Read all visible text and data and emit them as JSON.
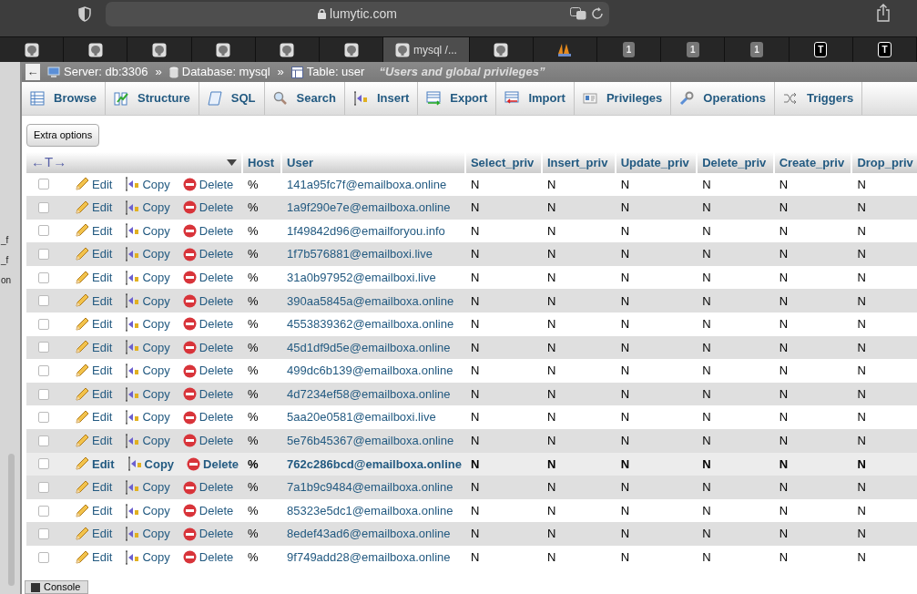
{
  "browser": {
    "address": "lumytic.com"
  },
  "browser_tabs": [
    {
      "kind": "pma",
      "selected": false
    },
    {
      "kind": "pma",
      "selected": false
    },
    {
      "kind": "pma",
      "selected": false
    },
    {
      "kind": "pma",
      "selected": false
    },
    {
      "kind": "pma",
      "selected": false
    },
    {
      "kind": "pma",
      "selected": false
    },
    {
      "kind": "pma",
      "selected": true,
      "title": "mysql /..."
    },
    {
      "kind": "pma",
      "selected": false
    },
    {
      "kind": "logo",
      "selected": false
    },
    {
      "kind": "badge",
      "selected": false,
      "text": "1"
    },
    {
      "kind": "badge",
      "selected": false,
      "text": "1"
    },
    {
      "kind": "badge",
      "selected": false,
      "text": "1"
    },
    {
      "kind": "letter",
      "selected": false,
      "text": "T"
    },
    {
      "kind": "letter",
      "selected": false,
      "text": "T"
    }
  ],
  "sidebar": {
    "fragments": [
      "_f",
      "_f",
      "on"
    ]
  },
  "breadcrumb": {
    "back": "←",
    "server": "Server: db:3306",
    "sep1": "»",
    "database": "Database: mysql",
    "sep2": "»",
    "table": "Table: user",
    "comment": "“Users and global privileges”"
  },
  "tabs": [
    {
      "label": "Browse",
      "selected": false
    },
    {
      "label": "Structure",
      "selected": false
    },
    {
      "label": "SQL",
      "selected": false
    },
    {
      "label": "Search",
      "selected": false
    },
    {
      "label": "Insert",
      "selected": false
    },
    {
      "label": "Export",
      "selected": false
    },
    {
      "label": "Import",
      "selected": false
    },
    {
      "label": "Privileges",
      "selected": false
    },
    {
      "label": "Operations",
      "selected": false
    },
    {
      "label": "Triggers",
      "selected": false
    }
  ],
  "extra_options": "Extra options",
  "table": {
    "arrows": "←T→",
    "columns": [
      "Host",
      "User",
      "Select_priv",
      "Insert_priv",
      "Update_priv",
      "Delete_priv",
      "Create_priv",
      "Drop_priv"
    ],
    "rows": [
      {
        "checked": false,
        "highlighted": false,
        "actions": [
          "Edit",
          "Copy",
          "Delete"
        ],
        "cells": [
          "%",
          "141a95fc7f@emailboxa.online",
          "N",
          "N",
          "N",
          "N",
          "N",
          "N"
        ]
      },
      {
        "checked": false,
        "highlighted": false,
        "actions": [
          "Edit",
          "Copy",
          "Delete"
        ],
        "cells": [
          "%",
          "1a9f290e7e@emailboxa.online",
          "N",
          "N",
          "N",
          "N",
          "N",
          "N"
        ]
      },
      {
        "checked": false,
        "highlighted": false,
        "actions": [
          "Edit",
          "Copy",
          "Delete"
        ],
        "cells": [
          "%",
          "1f49842d96@emailforyou.info",
          "N",
          "N",
          "N",
          "N",
          "N",
          "N"
        ]
      },
      {
        "checked": false,
        "highlighted": false,
        "actions": [
          "Edit",
          "Copy",
          "Delete"
        ],
        "cells": [
          "%",
          "1f7b576881@emailboxi.live",
          "N",
          "N",
          "N",
          "N",
          "N",
          "N"
        ]
      },
      {
        "checked": false,
        "highlighted": false,
        "actions": [
          "Edit",
          "Copy",
          "Delete"
        ],
        "cells": [
          "%",
          "31a0b97952@emailboxi.live",
          "N",
          "N",
          "N",
          "N",
          "N",
          "N"
        ]
      },
      {
        "checked": false,
        "highlighted": false,
        "actions": [
          "Edit",
          "Copy",
          "Delete"
        ],
        "cells": [
          "%",
          "390aa5845a@emailboxa.online",
          "N",
          "N",
          "N",
          "N",
          "N",
          "N"
        ]
      },
      {
        "checked": false,
        "highlighted": false,
        "actions": [
          "Edit",
          "Copy",
          "Delete"
        ],
        "cells": [
          "%",
          "4553839362@emailboxa.online",
          "N",
          "N",
          "N",
          "N",
          "N",
          "N"
        ]
      },
      {
        "checked": false,
        "highlighted": false,
        "actions": [
          "Edit",
          "Copy",
          "Delete"
        ],
        "cells": [
          "%",
          "45d1df9d5e@emailboxa.online",
          "N",
          "N",
          "N",
          "N",
          "N",
          "N"
        ]
      },
      {
        "checked": false,
        "highlighted": false,
        "actions": [
          "Edit",
          "Copy",
          "Delete"
        ],
        "cells": [
          "%",
          "499dc6b139@emailboxa.online",
          "N",
          "N",
          "N",
          "N",
          "N",
          "N"
        ]
      },
      {
        "checked": false,
        "highlighted": false,
        "actions": [
          "Edit",
          "Copy",
          "Delete"
        ],
        "cells": [
          "%",
          "4d7234ef58@emailboxa.online",
          "N",
          "N",
          "N",
          "N",
          "N",
          "N"
        ]
      },
      {
        "checked": false,
        "highlighted": false,
        "actions": [
          "Edit",
          "Copy",
          "Delete"
        ],
        "cells": [
          "%",
          "5aa20e0581@emailboxi.live",
          "N",
          "N",
          "N",
          "N",
          "N",
          "N"
        ]
      },
      {
        "checked": false,
        "highlighted": false,
        "actions": [
          "Edit",
          "Copy",
          "Delete"
        ],
        "cells": [
          "%",
          "5e76b45367@emailboxa.online",
          "N",
          "N",
          "N",
          "N",
          "N",
          "N"
        ]
      },
      {
        "checked": false,
        "highlighted": true,
        "actions": [
          "Edit",
          "Copy",
          "Delete"
        ],
        "cells": [
          "%",
          "762c286bcd@emailboxa.online",
          "N",
          "N",
          "N",
          "N",
          "N",
          "N"
        ]
      },
      {
        "checked": false,
        "highlighted": false,
        "actions": [
          "Edit",
          "Copy",
          "Delete"
        ],
        "cells": [
          "%",
          "7a1b9c9484@emailboxa.online",
          "N",
          "N",
          "N",
          "N",
          "N",
          "N"
        ]
      },
      {
        "checked": false,
        "highlighted": false,
        "actions": [
          "Edit",
          "Copy",
          "Delete"
        ],
        "cells": [
          "%",
          "85323e5dc1@emailboxa.online",
          "N",
          "N",
          "N",
          "N",
          "N",
          "N"
        ]
      },
      {
        "checked": false,
        "highlighted": false,
        "actions": [
          "Edit",
          "Copy",
          "Delete"
        ],
        "cells": [
          "%",
          "8edef43ad6@emailboxa.online",
          "N",
          "N",
          "N",
          "N",
          "N",
          "N"
        ]
      },
      {
        "checked": false,
        "highlighted": false,
        "actions": [
          "Edit",
          "Copy",
          "Delete"
        ],
        "cells": [
          "%",
          "9f749add28@emailboxa.online",
          "N",
          "N",
          "N",
          "N",
          "N",
          "N"
        ]
      }
    ]
  },
  "console": "Console"
}
